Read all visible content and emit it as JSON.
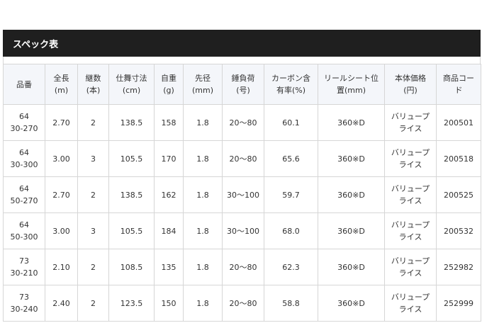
{
  "section": {
    "title": "スペック表"
  },
  "table": {
    "headers": [
      [
        "品番"
      ],
      [
        "全長",
        "(m)"
      ],
      [
        "継数",
        "(本)"
      ],
      [
        "仕舞寸法",
        "(cm)"
      ],
      [
        "自重",
        "(g)"
      ],
      [
        "先径",
        "(mm)"
      ],
      [
        "錘負荷",
        "(号)"
      ],
      [
        "カーボン含",
        "有率(%)"
      ],
      [
        "リールシート位",
        "置(mm)"
      ],
      [
        "本体価格",
        "(円)"
      ],
      [
        "商品コー",
        "ド"
      ]
    ],
    "rows": [
      {
        "model": [
          "64",
          "30-270"
        ],
        "length": "2.70",
        "sections": "2",
        "closed": "138.5",
        "weight": "158",
        "tip": "1.8",
        "load": "20～80",
        "carbon": "60.1",
        "reel": "360※D",
        "price": [
          "バリュープ",
          "ライス"
        ],
        "code": "200501"
      },
      {
        "model": [
          "64",
          "30-300"
        ],
        "length": "3.00",
        "sections": "3",
        "closed": "105.5",
        "weight": "170",
        "tip": "1.8",
        "load": "20～80",
        "carbon": "65.6",
        "reel": "360※D",
        "price": [
          "バリュープ",
          "ライス"
        ],
        "code": "200518"
      },
      {
        "model": [
          "64",
          "50-270"
        ],
        "length": "2.70",
        "sections": "2",
        "closed": "138.5",
        "weight": "162",
        "tip": "1.8",
        "load": "30～100",
        "carbon": "59.7",
        "reel": "360※D",
        "price": [
          "バリュープ",
          "ライス"
        ],
        "code": "200525"
      },
      {
        "model": [
          "64",
          "50-300"
        ],
        "length": "3.00",
        "sections": "3",
        "closed": "105.5",
        "weight": "184",
        "tip": "1.8",
        "load": "30～100",
        "carbon": "68.0",
        "reel": "360※D",
        "price": [
          "バリュープ",
          "ライス"
        ],
        "code": "200532"
      },
      {
        "model": [
          "73",
          "30-210"
        ],
        "length": "2.10",
        "sections": "2",
        "closed": "108.5",
        "weight": "135",
        "tip": "1.8",
        "load": "20～80",
        "carbon": "62.3",
        "reel": "360※D",
        "price": [
          "バリュープ",
          "ライス"
        ],
        "code": "252982"
      },
      {
        "model": [
          "73",
          "30-240"
        ],
        "length": "2.40",
        "sections": "2",
        "closed": "123.5",
        "weight": "150",
        "tip": "1.8",
        "load": "20～80",
        "carbon": "58.8",
        "reel": "360※D",
        "price": [
          "バリュープ",
          "ライス"
        ],
        "code": "252999"
      }
    ]
  }
}
